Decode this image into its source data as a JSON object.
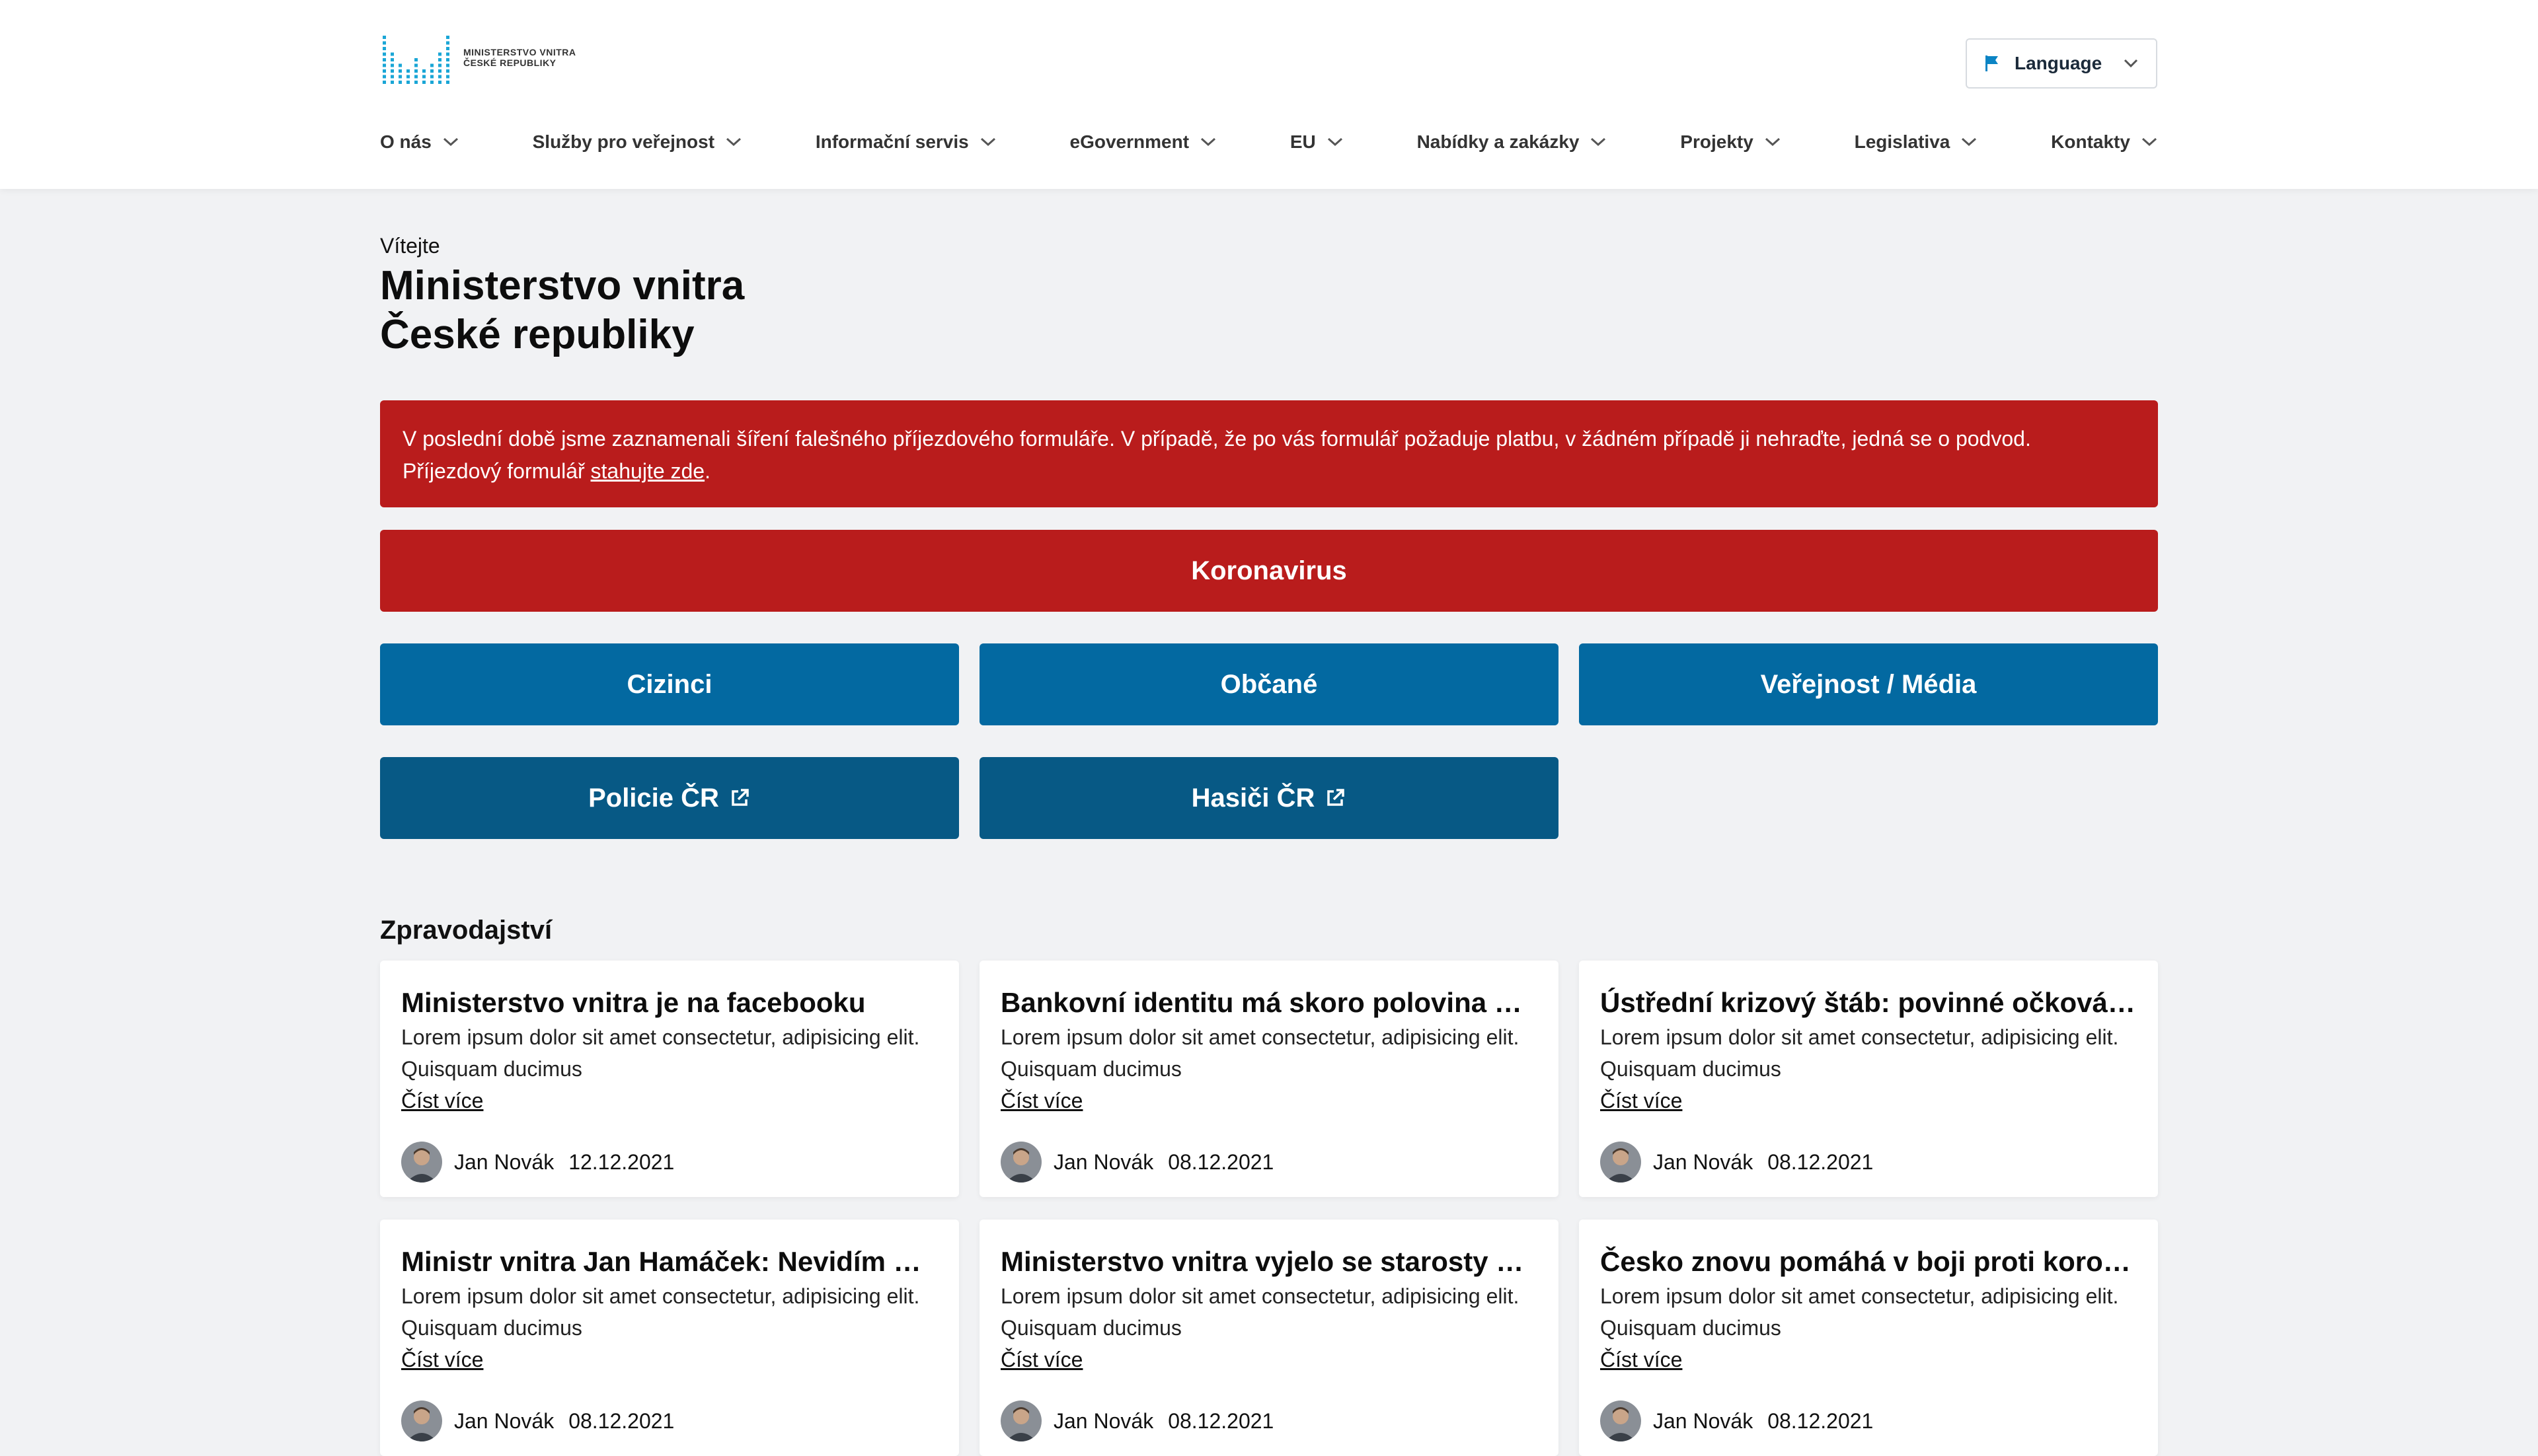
{
  "header": {
    "logo_lines": [
      "MINISTERSTVO VNITRA",
      "ČESKÉ REPUBLIKY"
    ],
    "language_label": "Language",
    "nav": [
      {
        "label": "O nás"
      },
      {
        "label": "Služby pro veřejnost"
      },
      {
        "label": "Informační servis"
      },
      {
        "label": "eGovernment"
      },
      {
        "label": "EU"
      },
      {
        "label": "Nabídky a zakázky"
      },
      {
        "label": "Projekty"
      },
      {
        "label": "Legislativa"
      },
      {
        "label": "Kontakty"
      }
    ]
  },
  "hero": {
    "welcome": "Vítejte",
    "title_line1": "Ministerstvo vnitra",
    "title_line2": "České republiky"
  },
  "alert": {
    "text_before": "V poslední době jsme zaznamenali šíření falešného příjezdového formuláře. V případě, že po vás formulář požaduje platbu, v žádném případě ji nehraďte, jedná se o podvod. Příjezdový formulář ",
    "link": "stahujte zde",
    "text_after": "."
  },
  "buttons": {
    "corona": "Koronavirus",
    "cizinci": "Cizinci",
    "obcane": "Občané",
    "verejnost": "Veřejnost / Média",
    "policie": "Policie ČR",
    "hasici": "Hasiči ČR"
  },
  "news": {
    "section_title": "Zpravodajství",
    "read_more": "Číst více",
    "items": [
      {
        "title": "Ministerstvo vnitra je na facebooku",
        "text1": "Lorem ipsum dolor sit amet consectetur, adipisicing elit.",
        "text2": "Quisquam ducimus",
        "author": "Jan Novák",
        "date": "12.12.2021"
      },
      {
        "title": "Bankovní identitu má skoro polovina Čech...",
        "text1": "Lorem ipsum dolor sit amet consectetur, adipisicing elit.",
        "text2": "Quisquam ducimus",
        "author": "Jan Novák",
        "date": "08.12.2021"
      },
      {
        "title": "Ústřední krizový štáb: povinné očkování pr...",
        "text1": "Lorem ipsum dolor sit amet consectetur, adipisicing elit.",
        "text2": "Quisquam ducimus",
        "author": "Jan Novák",
        "date": "08.12.2021"
      },
      {
        "title": "Ministr vnitra Jan Hamáček: Nevidím důvo...",
        "text1": "Lorem ipsum dolor sit amet consectetur, adipisicing elit.",
        "text2": "Quisquam ducimus",
        "author": "Jan Novák",
        "date": "08.12.2021"
      },
      {
        "title": "Ministerstvo vnitra vyjelo se starosty obcí ...",
        "text1": "Lorem ipsum dolor sit amet consectetur, adipisicing elit.",
        "text2": "Quisquam ducimus",
        "author": "Jan Novák",
        "date": "08.12.2021"
      },
      {
        "title": "Česko znovu pomáhá v boji proti koronavi...",
        "text1": "Lorem ipsum dolor sit amet consectetur, adipisicing elit.",
        "text2": "Quisquam ducimus",
        "author": "Jan Novák",
        "date": "08.12.2021"
      }
    ]
  },
  "colors": {
    "alert_red": "#b91c1c",
    "primary_blue": "#0369a1",
    "dark_blue": "#075985",
    "logo_cyan": "#1aa6d6"
  },
  "icons": [
    "ministry-logo-icon",
    "flag-icon",
    "chevron-down-icon",
    "external-link-icon",
    "avatar"
  ]
}
